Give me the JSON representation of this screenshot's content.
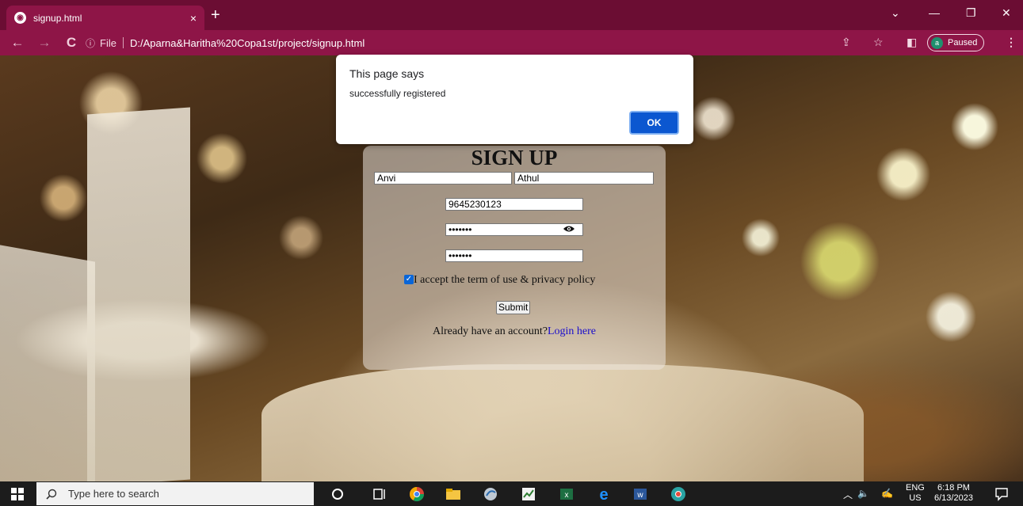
{
  "browser": {
    "tab_title": "signup.html",
    "tab_close": "×",
    "new_tab": "+",
    "address_info": "ⓘ",
    "address_scheme": "File",
    "url": "D:/Aparna&Haritha%20Copa1st/project/signup.html",
    "profile_initial": "a",
    "profile_status": "Paused",
    "minimize": "—",
    "restore": "❐",
    "close": "✕",
    "tablist": "⌄"
  },
  "form": {
    "title": "SIGN UP",
    "first_name": "Anvi",
    "last_name": "Athul",
    "phone": "9645230123",
    "password_mask": "•••••••",
    "confirm_mask": "•••••••",
    "terms_label": "I accept the term of use & privacy policy",
    "terms_checked": true,
    "submit_label": "Submit",
    "already_text": "Already have an account?",
    "login_link": "Login here"
  },
  "dialog": {
    "title": "This page says",
    "message": "successfully registered",
    "ok_label": "OK"
  },
  "taskbar": {
    "search_placeholder": "Type here to search",
    "lang_top": "ENG",
    "lang_bottom": "US",
    "time": "6:18 PM",
    "date": "6/13/2023"
  },
  "colors": {
    "chrome_dark": "#6b0d33",
    "chrome": "#8e1547",
    "ok_button": "#0b57d0",
    "link": "#1a0dcc"
  }
}
